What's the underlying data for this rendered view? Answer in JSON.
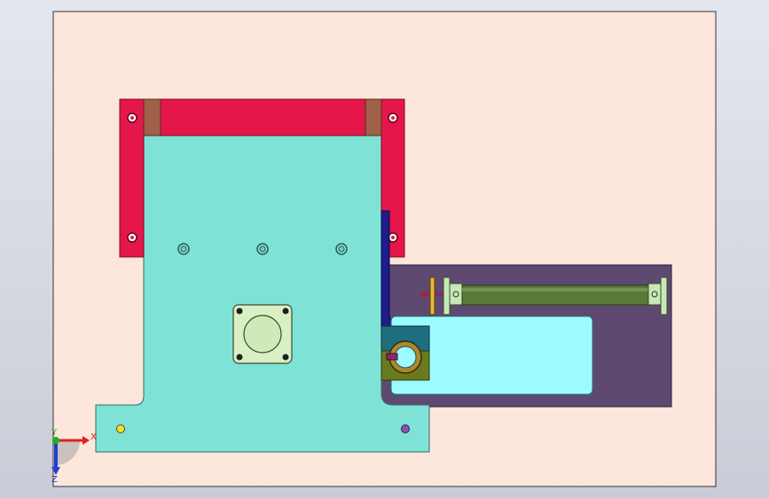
{
  "viewport": {
    "background_gradient": [
      "#e4e7ee",
      "#c9ccd6"
    ]
  },
  "drawing_sheet": {
    "fill": "#fde6dc",
    "border": "#333333"
  },
  "parts": {
    "base_plate": {
      "color": "#7ee3d6",
      "outline": "#2e6e66"
    },
    "u_frame": {
      "color": "#e5164a",
      "spacer_color": "#a0604a"
    },
    "riser_bar": {
      "color": "#1f1c8c"
    },
    "cylinder_base": {
      "color": "#5e4a70"
    },
    "slot_window": {
      "color": "#9cfbff"
    },
    "flange_block": {
      "color": "#d8f0c4"
    },
    "clamp_block_upper": {
      "color": "#1e6e80"
    },
    "clamp_block_lower": {
      "color": "#6a7a1e"
    },
    "air_cylinder": {
      "color": "#5a7a3a"
    },
    "end_brackets": {
      "color": "#c9e8b8"
    },
    "rod_end_collar": {
      "color": "#e8b830"
    },
    "markers": {
      "yellow": "#f0e030",
      "purple": "#8a55a8"
    }
  },
  "triad": {
    "x_label": "X",
    "y_label": "Y",
    "z_label": "Z",
    "x_color": "#e02020",
    "y_color": "#20b020",
    "z_color": "#2040d0"
  }
}
